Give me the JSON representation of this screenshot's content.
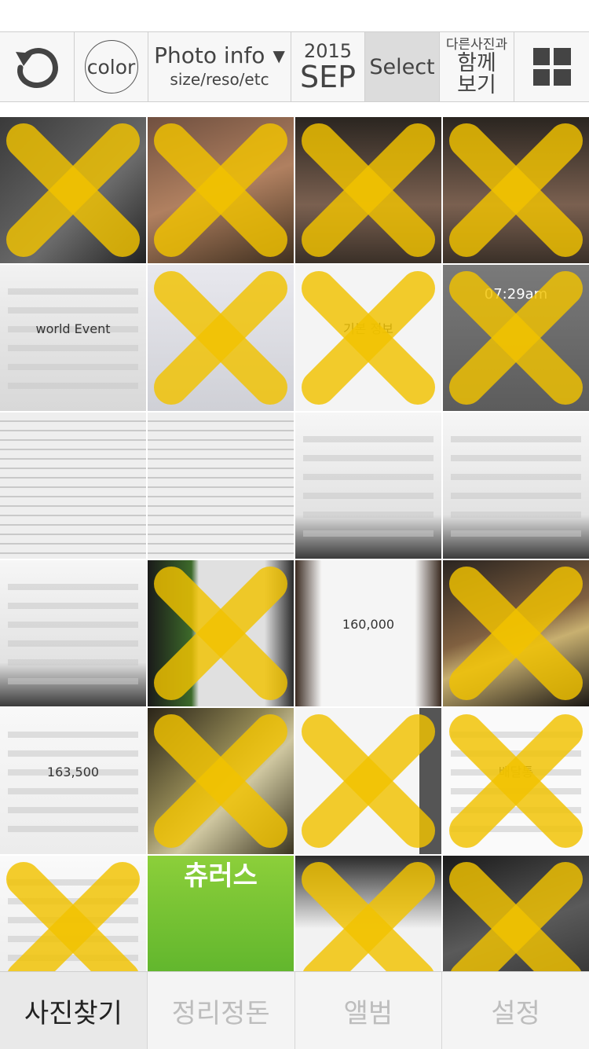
{
  "toolbar": {
    "color_label": "color",
    "info_title": "Photo info",
    "info_sub": "size/reso/etc",
    "info_arrow": "▼",
    "year": "2015",
    "month": "SEP",
    "select_label": "Select",
    "together_line1": "다른사진과",
    "together_line2": "함께",
    "together_line3": "보기"
  },
  "icons": {
    "back": "undo-arrow-icon",
    "grid": "grid-view-icon"
  },
  "photos": [
    {
      "kind": "bg-dark",
      "marked": true,
      "caption": ""
    },
    {
      "kind": "bg-photo-warm",
      "marked": true,
      "caption": ""
    },
    {
      "kind": "bg-face",
      "marked": true,
      "caption": ""
    },
    {
      "kind": "bg-face",
      "marked": true,
      "caption": ""
    },
    {
      "kind": "bg-web",
      "marked": false,
      "caption": "world Event"
    },
    {
      "kind": "bg-web2",
      "marked": true,
      "caption": ""
    },
    {
      "kind": "bg-app",
      "marked": true,
      "caption": "기본 정보"
    },
    {
      "kind": "bg-gray-app",
      "marked": true,
      "caption": "07:29am"
    },
    {
      "kind": "bg-sheet",
      "marked": false,
      "caption": ""
    },
    {
      "kind": "bg-sheet",
      "marked": false,
      "caption": ""
    },
    {
      "kind": "bg-screen",
      "marked": false,
      "caption": ""
    },
    {
      "kind": "bg-screen",
      "marked": false,
      "caption": ""
    },
    {
      "kind": "bg-screen",
      "marked": false,
      "caption": ""
    },
    {
      "kind": "bg-green-phone",
      "marked": true,
      "caption": ""
    },
    {
      "kind": "bg-receipt",
      "marked": false,
      "caption": "160,000"
    },
    {
      "kind": "bg-street",
      "marked": true,
      "caption": ""
    },
    {
      "kind": "bg-receipt2",
      "marked": false,
      "caption": "163,500"
    },
    {
      "kind": "bg-money",
      "marked": true,
      "caption": ""
    },
    {
      "kind": "bg-doc",
      "marked": true,
      "caption": ""
    },
    {
      "kind": "bg-list",
      "marked": true,
      "caption": "배달통"
    },
    {
      "kind": "bg-menu",
      "marked": true,
      "caption": ""
    },
    {
      "kind": "bg-churros",
      "marked": false,
      "caption": "츄러스"
    },
    {
      "kind": "bg-product",
      "marked": true,
      "caption": ""
    },
    {
      "kind": "bg-concert",
      "marked": true,
      "caption": ""
    }
  ],
  "colors": {
    "x_mark": "#f2c300"
  },
  "tabs": [
    {
      "label": "사진찾기",
      "active": true
    },
    {
      "label": "정리정돈",
      "active": false
    },
    {
      "label": "앨범",
      "active": false
    },
    {
      "label": "설정",
      "active": false
    }
  ]
}
